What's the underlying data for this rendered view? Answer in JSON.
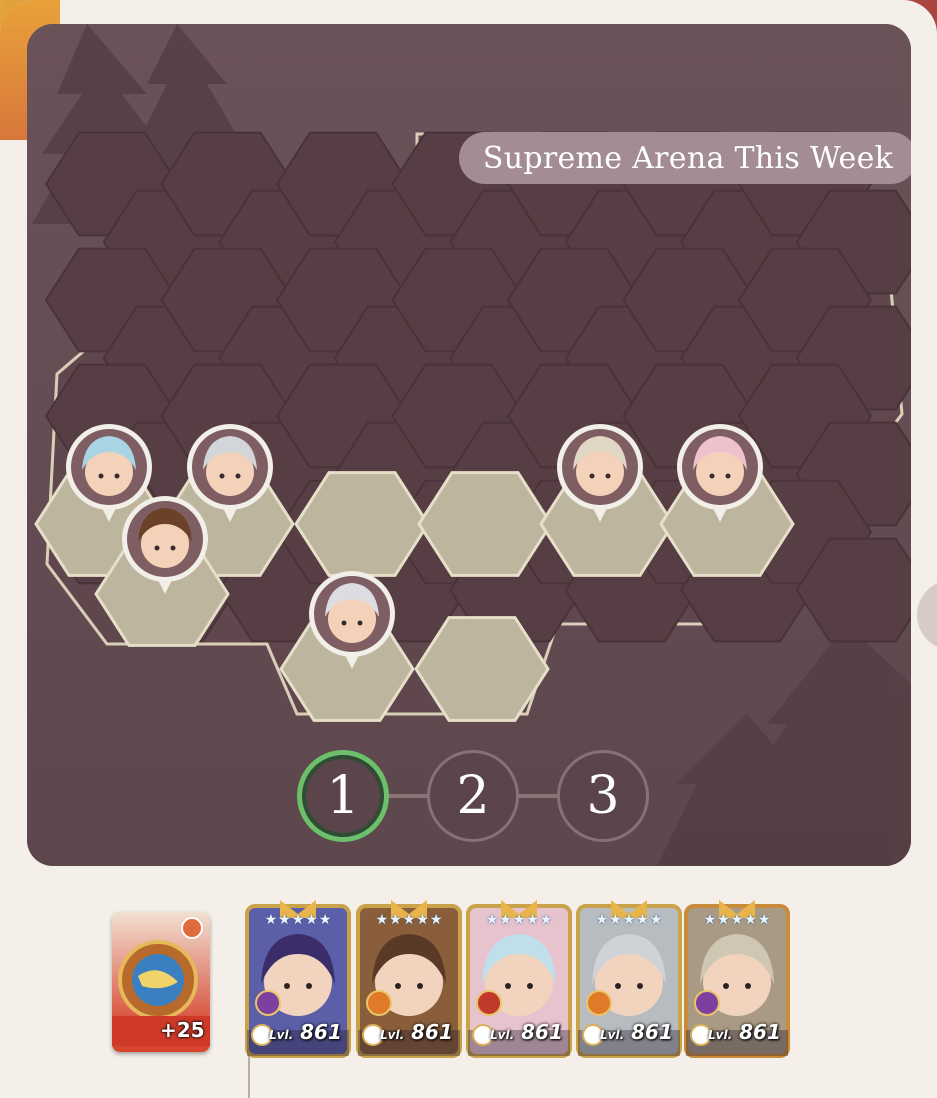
{
  "header": {
    "title": "Supreme Arena This Week"
  },
  "colors": {
    "board_bg": "#6b5359",
    "hex_empty": "#5a4146",
    "hex_outline": "#d9cfb8",
    "hex_occupied": "#bdb59d",
    "active_stage_ring": "#6cbf6b",
    "panel_bg": "#f4efe9"
  },
  "stages": [
    {
      "label": "1",
      "active": true
    },
    {
      "label": "2",
      "active": false
    },
    {
      "label": "3",
      "active": false
    }
  ],
  "enemy_heroes": [
    {
      "name": "hero-blue-hair-icon"
    },
    {
      "name": "hero-silver-helm-icon"
    },
    {
      "name": "hero-brown-curls-icon"
    },
    {
      "name": "hero-white-hair-headband-icon"
    },
    {
      "name": "hero-bearded-elder-icon"
    },
    {
      "name": "hero-pink-hair-icon"
    }
  ],
  "artifact": {
    "bonus": "+25",
    "icon": "artifact-orb-icon"
  },
  "team": [
    {
      "level_prefix": "Lvl.",
      "level": "861",
      "faction_color": "#7d3fa0",
      "frame_color": "#c9a24a",
      "icon": "hero-purple-hair-icon"
    },
    {
      "level_prefix": "Lvl.",
      "level": "861",
      "faction_color": "#e07a28",
      "frame_color": "#c9a24a",
      "icon": "hero-brown-curls-icon"
    },
    {
      "level_prefix": "Lvl.",
      "level": "861",
      "faction_color": "#c0392b",
      "frame_color": "#c9a24a",
      "icon": "hero-twins-icon"
    },
    {
      "level_prefix": "Lvl.",
      "level": "861",
      "faction_color": "#e07a28",
      "frame_color": "#c9a24a",
      "icon": "hero-silver-helm-icon"
    },
    {
      "level_prefix": "Lvl.",
      "level": "861",
      "faction_color": "#7d3fa0",
      "frame_color": "#c98a3a",
      "icon": "hero-bearded-elder-icon"
    }
  ]
}
